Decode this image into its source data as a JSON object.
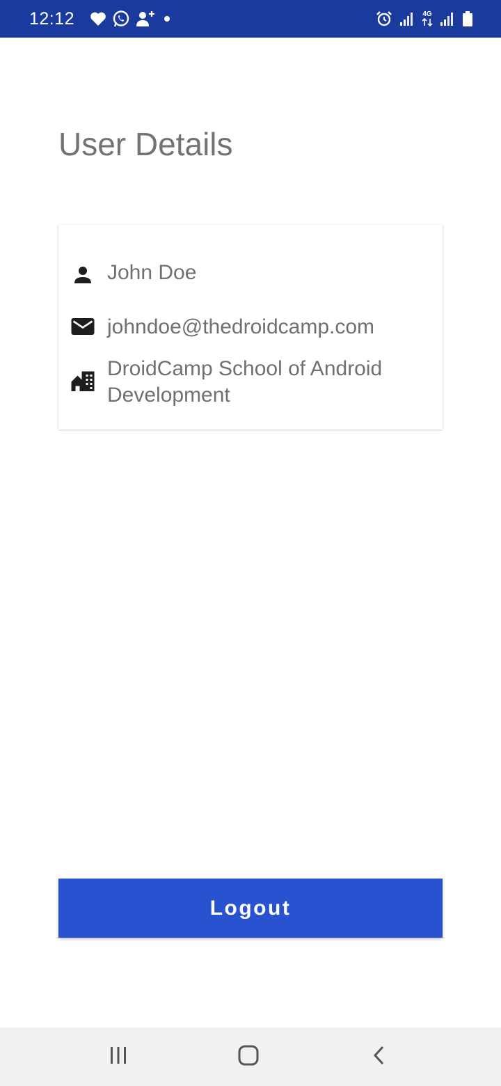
{
  "status_bar": {
    "time": "12:12",
    "left_icons": [
      "heart-icon",
      "whatsapp-icon",
      "add-contact-icon",
      "dot-icon"
    ],
    "network_label": "4G",
    "right_icons": [
      "alarm-icon",
      "signal-icon",
      "network-4g-icon",
      "signal-icon",
      "battery-icon"
    ]
  },
  "page": {
    "title": "User Details"
  },
  "user": {
    "name": "John Doe",
    "email": "johndoe@thedroidcamp.com",
    "organization": "DroidCamp School of Android Development"
  },
  "actions": {
    "logout_label": "Logout"
  },
  "colors": {
    "status_bar": "#1a3a9e",
    "accent": "#2952d1",
    "title_text": "#737373",
    "body_text": "#707070",
    "nav_bar": "#f1f1f1"
  }
}
